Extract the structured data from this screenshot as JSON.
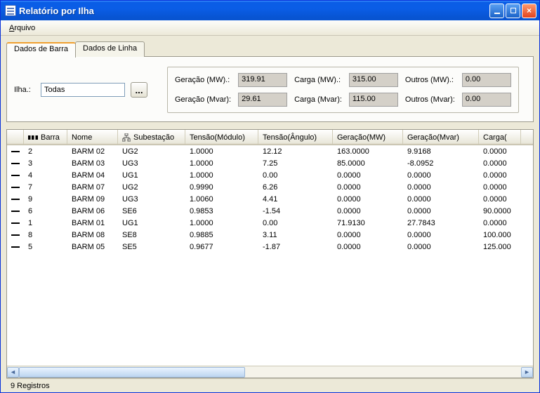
{
  "window": {
    "title": "Relatório por Ilha"
  },
  "menu": {
    "arquivo": "Arquivo"
  },
  "tabs": {
    "barra": "Dados de Barra",
    "linha": "Dados de Linha"
  },
  "filter": {
    "ilha_label": "Ilha.:",
    "ilha_value": "Todas",
    "dots": "..."
  },
  "summary": {
    "ger_mw_label": "Geração (MW).:",
    "ger_mw": "319.91",
    "carga_mw_label": "Carga (MW).:",
    "carga_mw": "315.00",
    "outros_mw_label": "Outros (MW).:",
    "outros_mw": "0.00",
    "ger_mvar_label": "Geração (Mvar):",
    "ger_mvar": "29.61",
    "carga_mvar_label": "Carga (Mvar):",
    "carga_mvar": "115.00",
    "outros_mvar_label": "Outros (Mvar):",
    "outros_mvar": "0.00"
  },
  "grid": {
    "headers": {
      "barra": "Barra",
      "nome": "Nome",
      "sub": "Subestação",
      "tmod": "Tensão(Módulo)",
      "tang": "Tensão(Ângulo)",
      "gmw": "Geração(MW)",
      "gmvar": "Geração(Mvar)",
      "carga": "Carga("
    },
    "rows": [
      {
        "barra": "2",
        "nome": "BARM 02",
        "sub": "UG2",
        "tmod": "1.0000",
        "tang": "12.12",
        "gmw": "163.0000",
        "gmvar": "9.9168",
        "carga": "0.0000"
      },
      {
        "barra": "3",
        "nome": "BARM 03",
        "sub": "UG3",
        "tmod": "1.0000",
        "tang": "7.25",
        "gmw": "85.0000",
        "gmvar": "-8.0952",
        "carga": "0.0000"
      },
      {
        "barra": "4",
        "nome": "BARM 04",
        "sub": "UG1",
        "tmod": "1.0000",
        "tang": "0.00",
        "gmw": "0.0000",
        "gmvar": "0.0000",
        "carga": "0.0000"
      },
      {
        "barra": "7",
        "nome": "BARM 07",
        "sub": "UG2",
        "tmod": "0.9990",
        "tang": "6.26",
        "gmw": "0.0000",
        "gmvar": "0.0000",
        "carga": "0.0000"
      },
      {
        "barra": "9",
        "nome": "BARM 09",
        "sub": "UG3",
        "tmod": "1.0060",
        "tang": "4.41",
        "gmw": "0.0000",
        "gmvar": "0.0000",
        "carga": "0.0000"
      },
      {
        "barra": "6",
        "nome": "BARM 06",
        "sub": "SE6",
        "tmod": "0.9853",
        "tang": "-1.54",
        "gmw": "0.0000",
        "gmvar": "0.0000",
        "carga": "90.0000"
      },
      {
        "barra": "1",
        "nome": "BARM 01",
        "sub": "UG1",
        "tmod": "1.0000",
        "tang": "0.00",
        "gmw": "71.9130",
        "gmvar": "27.7843",
        "carga": "0.0000"
      },
      {
        "barra": "8",
        "nome": "BARM 08",
        "sub": "SE8",
        "tmod": "0.9885",
        "tang": "3.11",
        "gmw": "0.0000",
        "gmvar": "0.0000",
        "carga": "100.000"
      },
      {
        "barra": "5",
        "nome": "BARM 05",
        "sub": "SE5",
        "tmod": "0.9677",
        "tang": "-1.87",
        "gmw": "0.0000",
        "gmvar": "0.0000",
        "carga": "125.000"
      }
    ]
  },
  "status": {
    "text": "9 Registros"
  }
}
